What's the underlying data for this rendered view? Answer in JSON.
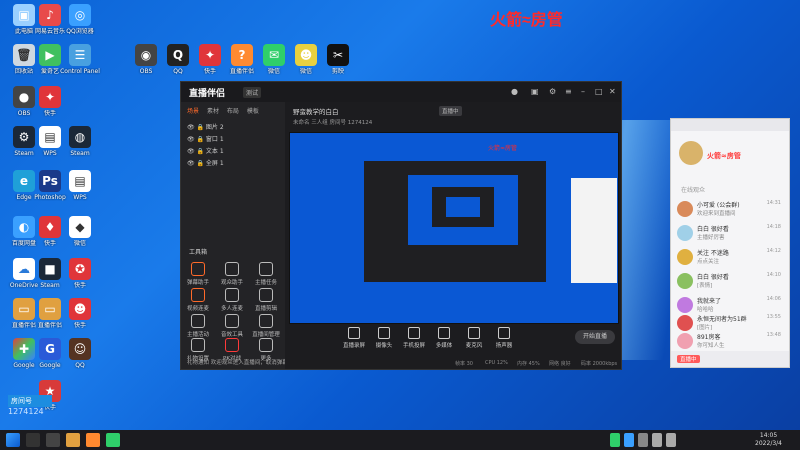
{
  "watermark": "火箭≈房管",
  "desktop_icons": [
    {
      "label": "此电脑",
      "icon": "computer-icon",
      "color": "#9ad0ff"
    },
    {
      "label": "网易云音乐",
      "icon": "music-icon",
      "color": "#e84a4a"
    },
    {
      "label": "QQ浏览器",
      "icon": "browser-icon",
      "color": "#3aa0ff"
    },
    {
      "label": "回收站",
      "icon": "trash-icon",
      "color": "#cfd8e0"
    },
    {
      "label": "爱奇艺",
      "icon": "video-icon",
      "color": "#40c060"
    },
    {
      "label": "Control Panel",
      "icon": "panel-icon",
      "color": "#48a0e0"
    },
    {
      "label": "OBS",
      "icon": "obs-icon",
      "color": "#444"
    },
    {
      "label": "QQ",
      "icon": "qq-icon",
      "color": "#222"
    },
    {
      "label": "快手",
      "icon": "app-icon",
      "color": "#e0353a"
    },
    {
      "label": "直播伴侣",
      "icon": "live-icon",
      "color": "#ff8a30"
    },
    {
      "label": "微信",
      "icon": "wechat-icon",
      "color": "#2fcf6a"
    },
    {
      "label": "剪映",
      "icon": "edit-icon",
      "color": "#111"
    },
    {
      "label": "Steam",
      "icon": "steam-icon",
      "color": "#1b2838"
    },
    {
      "label": "Edge",
      "icon": "edge-icon",
      "color": "#1fa0d8"
    },
    {
      "label": "WPS",
      "icon": "wps-icon",
      "color": "#d83a3a"
    },
    {
      "label": "OneDrive",
      "icon": "cloud-icon",
      "color": "#ffffff"
    },
    {
      "label": "百度网盘",
      "icon": "disk-icon",
      "color": "#3aa0ff"
    },
    {
      "label": "Photoshop",
      "icon": "ps-icon",
      "color": "#1a3a8a"
    },
    {
      "label": "Google",
      "icon": "google-icon",
      "color": "#ffcc33"
    }
  ],
  "stream_badge": {
    "name": "房间号",
    "room": "1274124"
  },
  "app": {
    "logo": "直播伴侣",
    "version": "测试",
    "tabs": [
      "场景",
      "素材",
      "布局",
      "模板"
    ],
    "sources": [
      "图片 2",
      "窗口 1",
      "文本 1",
      "全屏 1"
    ],
    "tools_title": "工具箱",
    "tools": [
      "弹幕助手",
      "观众助手",
      "主播任务",
      "视频连麦",
      "多人连麦",
      "直播剪辑",
      "主播活动",
      "音效工具",
      "直播间管理",
      "礼物设置",
      "PK对战",
      "更多"
    ],
    "notice": "礼物通知  欢迎观众进入直播间，取消弹幕",
    "scene_title": "野蛮教学的白白",
    "scene_tag": "直播中",
    "scene_meta": "未命名   三人组   房间号 1274124",
    "preview_text": "火箭≈房管",
    "controls": [
      "直播录屏",
      "摄像头",
      "手机投屏",
      "多媒体",
      "麦克风",
      "扬声器"
    ],
    "start_label": "开始直播",
    "status": [
      "帧率 30",
      "CPU 12%",
      "内存 45%",
      "网络 良好",
      "码率 2000kbps"
    ]
  },
  "chat": {
    "group_title": "火箭≈房管",
    "sub": "在线观众",
    "items": [
      {
        "name": "小可爱 (公会群)",
        "msg": "欢迎来到直播间",
        "time": "14:31",
        "color": "#d98a5a"
      },
      {
        "name": "白白 很好看",
        "msg": "主播好厉害",
        "time": "14:18",
        "color": "#a0d0e8"
      },
      {
        "name": "关注 不迷路",
        "msg": "点点关注",
        "time": "14:12",
        "color": "#e0b040"
      },
      {
        "name": "白白 很好看",
        "msg": "[表情]",
        "time": "14:10",
        "color": "#8ac060"
      },
      {
        "name": "我就来了",
        "msg": "哈哈哈",
        "time": "14:06",
        "color": "#c07ae0"
      },
      {
        "name": "永恒无间者为51群",
        "msg": "[图片]",
        "time": "13:55",
        "color": "#e05050"
      },
      {
        "name": "891房客",
        "msg": "你可知人生",
        "time": "13:48",
        "color": "#f0a0b0"
      }
    ],
    "live_badge": "直播中"
  },
  "clock": {
    "time": "14:05",
    "date": "2022/3/4"
  }
}
